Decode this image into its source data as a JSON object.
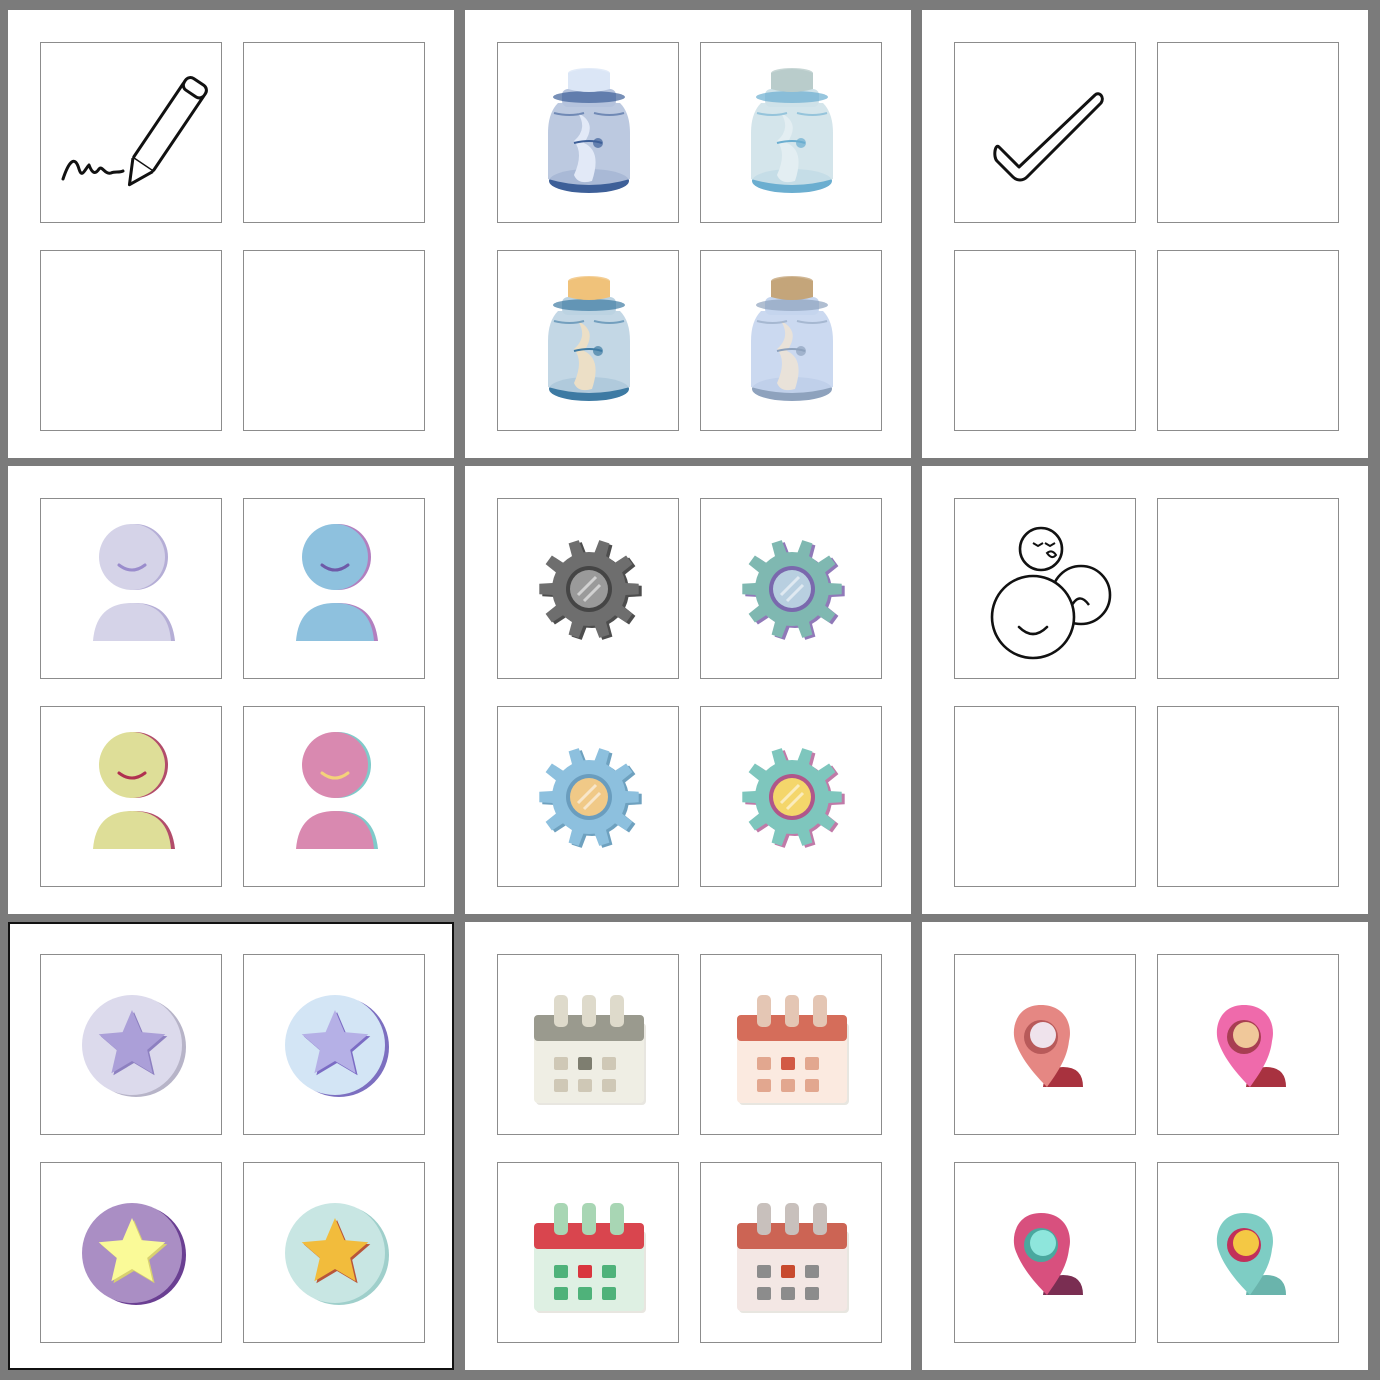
{
  "panels": [
    {
      "id": "signature",
      "icons": [
        "signature-icon",
        null,
        null,
        null
      ]
    },
    {
      "id": "message-bottle",
      "icons": [
        "message-bottle-icon",
        "message-bottle-icon",
        "message-bottle-icon",
        "message-bottle-icon"
      ],
      "variants": [
        {
          "cap": "#dbe6f6",
          "body": "#b5c3dd",
          "base": "#3d5f98",
          "paper": "#e2e9f7"
        },
        {
          "cap": "#b9cccb",
          "body": "#cfe2e9",
          "base": "#6baed0",
          "paper": "#e3eef2"
        },
        {
          "cap": "#f0c27a",
          "body": "#bcd3e2",
          "base": "#3d7aa3",
          "paper": "#ecdfc6"
        },
        {
          "cap": "#c4a57a",
          "body": "#c5d5ee",
          "base": "#8ea2bd",
          "paper": "#e9e2d9"
        }
      ]
    },
    {
      "id": "check",
      "icons": [
        "check-icon",
        null,
        null,
        null
      ]
    },
    {
      "id": "user",
      "icons": [
        "user-icon",
        "user-icon",
        "user-icon",
        "user-icon"
      ],
      "variants": [
        {
          "fill": "#d5d3e8",
          "shadow": "#b5aed6",
          "smile": "#9a8ccc"
        },
        {
          "fill": "#8ec1de",
          "shadow": "#b27fbf",
          "smile": "#6e5aa8"
        },
        {
          "fill": "#dede98",
          "shadow": "#b24c6a",
          "smile": "#b03050"
        },
        {
          "fill": "#d989b0",
          "shadow": "#7fcaca",
          "smile": "#f4d27a"
        }
      ]
    },
    {
      "id": "gear",
      "icons": [
        "gear-icon",
        "gear-icon",
        "gear-icon",
        "gear-icon"
      ],
      "variants": [
        {
          "fill": "#6e6e6e",
          "shadow": "#4d4d4d",
          "lens": "#9a9a9a",
          "ring": "#454545"
        },
        {
          "fill": "#7fb8b1",
          "shadow": "#9079b8",
          "lens": "#b8cfe0",
          "ring": "#7a68ad"
        },
        {
          "fill": "#8dc0de",
          "shadow": "#6ea1bf",
          "lens": "#f0c987",
          "ring": "#6a9dbe"
        },
        {
          "fill": "#7ec6bd",
          "shadow": "#c07aa8",
          "lens": "#f4d66b",
          "ring": "#b0568a"
        }
      ]
    },
    {
      "id": "bubble-faces",
      "icons": [
        "bubble-faces-icon",
        null,
        null,
        null
      ]
    },
    {
      "id": "star-badge",
      "selected": true,
      "icons": [
        "star-badge-icon",
        "star-badge-icon",
        "star-badge-icon",
        "star-badge-icon"
      ],
      "variants": [
        {
          "circle": "#dcdaec",
          "shadow": "#b7b4c8",
          "star": "#ab9fd8",
          "starEdge": "#8d80c0"
        },
        {
          "circle": "#d3e5f5",
          "shadow": "#7c6fc0",
          "star": "#b5b0e6",
          "starEdge": "#7b6cc4"
        },
        {
          "circle": "#aa8ec4",
          "shadow": "#6a3f92",
          "star": "#fafa98",
          "starEdge": "#d8d070"
        },
        {
          "circle": "#c8e6e3",
          "shadow": "#9fcfcb",
          "star": "#f2bc3c",
          "starEdge": "#b8563a"
        }
      ]
    },
    {
      "id": "calendar",
      "icons": [
        "calendar-icon",
        "calendar-icon",
        "calendar-icon",
        "calendar-icon"
      ],
      "variants": [
        {
          "rings": "#dedacb",
          "header": "#9a9a8e",
          "body": "#efeee4",
          "dot": "#cfc8b6",
          "accent": "#7e7e70"
        },
        {
          "rings": "#e4c6b4",
          "header": "#d56d5a",
          "body": "#fbeae0",
          "dot": "#e2a78f",
          "accent": "#d25a45"
        },
        {
          "rings": "#a8d6b4",
          "header": "#d9454e",
          "body": "#def0e3",
          "dot": "#4fb27a",
          "accent": "#d9363e"
        },
        {
          "rings": "#c8c0bc",
          "header": "#cc6454",
          "body": "#f3e7e4",
          "dot": "#8c8c8c",
          "accent": "#c84a2e"
        }
      ]
    },
    {
      "id": "location-user",
      "icons": [
        "location-user-icon",
        "location-user-icon",
        "location-user-icon",
        "location-user-icon"
      ],
      "variants": [
        {
          "pin": "#e58783",
          "inner": "#efe3ec",
          "ring": "#b85a5a",
          "user": "#a8323e"
        },
        {
          "pin": "#ef6aab",
          "inner": "#f0c89a",
          "ring": "#a83e52",
          "user": "#a83240"
        },
        {
          "pin": "#d8507e",
          "inner": "#8ee6dc",
          "ring": "#4aa89e",
          "user": "#7a2e52"
        },
        {
          "pin": "#7ecdc4",
          "inner": "#f4c844",
          "ring": "#c2305a",
          "user": "#6ab4ac"
        }
      ]
    }
  ]
}
